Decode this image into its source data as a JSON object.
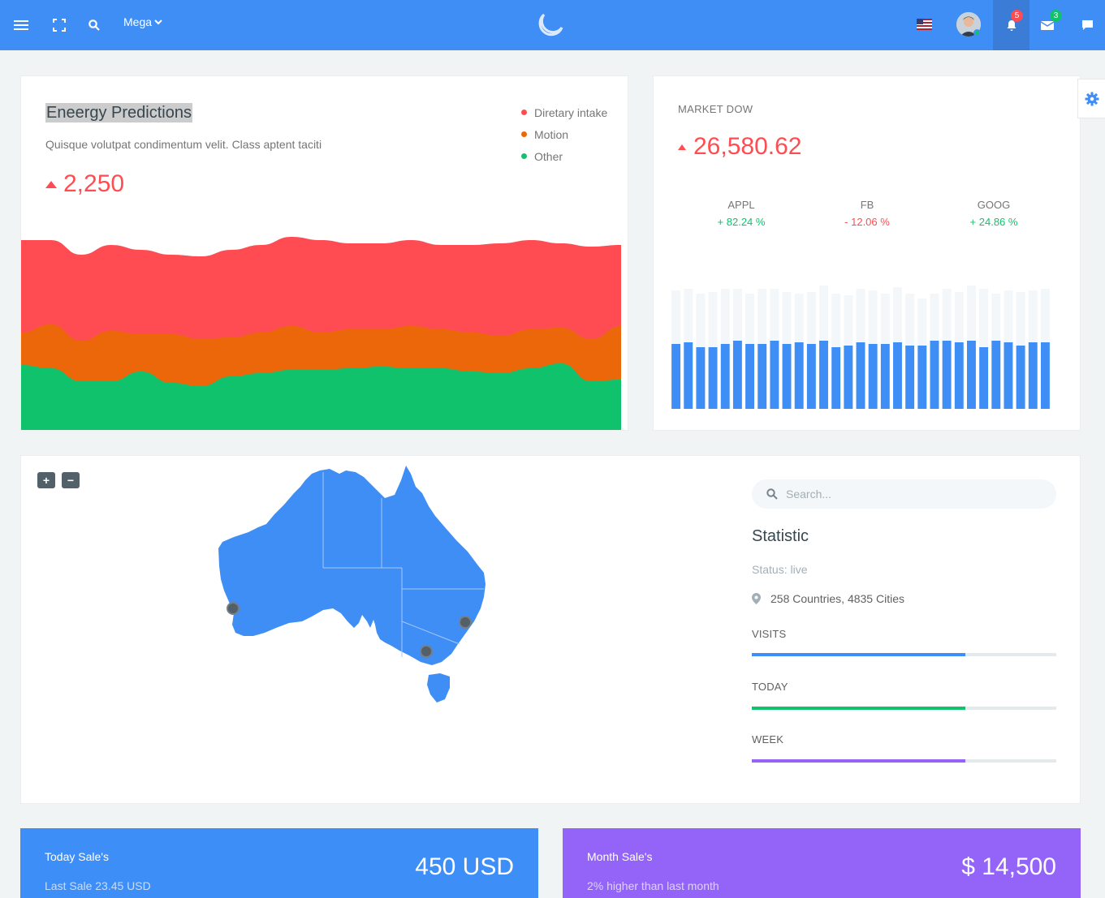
{
  "navbar": {
    "menu_icon": "hamburger-menu-icon",
    "fullscreen_icon": "fullscreen-icon",
    "search_icon": "search-icon",
    "mega_label": "Mega",
    "notifications_count": "5",
    "messages_count": "3",
    "brand_color": "#3f8ef6"
  },
  "energy": {
    "title": "Eneergy Predictions",
    "subtitle": "Quisque volutpat condimentum velit. Class aptent taciti",
    "value": "2,250",
    "legend": [
      {
        "label": "Diretary intake",
        "color": "#ff4c52"
      },
      {
        "label": "Motion",
        "color": "#eb6709"
      },
      {
        "label": "Other",
        "color": "#11c26d"
      }
    ]
  },
  "chart_data": [
    {
      "type": "area",
      "title": "Eneergy Predictions",
      "stacked": true,
      "series": [
        {
          "name": "Other",
          "color": "#11c26d",
          "values": [
            40,
            38,
            30,
            30,
            36,
            29,
            27,
            33,
            35,
            37,
            37,
            38,
            39,
            38,
            38,
            36,
            35,
            38,
            41,
            30,
            31
          ]
        },
        {
          "name": "Motion",
          "color": "#eb6709",
          "values": [
            20,
            27,
            25,
            31,
            23,
            30,
            29,
            24,
            25,
            27,
            23,
            24,
            23,
            26,
            24,
            24,
            23,
            24,
            22,
            26,
            33
          ]
        },
        {
          "name": "Diretary intake",
          "color": "#ff4c52",
          "values": [
            57,
            52,
            53,
            53,
            52,
            49,
            51,
            54,
            54,
            55,
            57,
            53,
            53,
            53,
            52,
            54,
            57,
            55,
            52,
            57,
            50
          ]
        }
      ]
    },
    {
      "type": "bar",
      "title": "MARKET DOW",
      "series": [
        {
          "name": "background",
          "color": "#f3f7f9",
          "values": [
            73,
            74,
            71,
            72,
            74,
            74,
            71,
            74,
            74,
            72,
            71,
            72,
            76,
            71,
            70,
            74,
            73,
            71,
            75,
            71,
            68,
            71,
            74,
            72,
            76,
            74,
            71,
            73,
            72
          ]
        },
        {
          "name": "value",
          "color": "#3f8ef6",
          "values": [
            40,
            41,
            38,
            38,
            40,
            42,
            40,
            40,
            42,
            40,
            41,
            40,
            42,
            38,
            39,
            41,
            40,
            40,
            41,
            39,
            39,
            42,
            42,
            41,
            42,
            38,
            42,
            41,
            39,
            41,
            41
          ]
        }
      ]
    }
  ],
  "market": {
    "title": "MARKET DOW",
    "value": "26,580.62",
    "tickers": [
      {
        "name": "APPL",
        "change": "+ 82.24 %",
        "color": "#11c26d"
      },
      {
        "name": "FB",
        "change": "- 12.06 %",
        "color": "#ff4c52"
      },
      {
        "name": "GOOG",
        "change": "+ 24.86 %",
        "color": "#11c26d"
      }
    ]
  },
  "map": {
    "zoom_in": "+",
    "zoom_out": "−",
    "region": "Australia",
    "map_color": "#3f8ef6",
    "marker_color": "#526069"
  },
  "stats": {
    "search_placeholder": "Search...",
    "title": "Statistic",
    "status": "Status: live",
    "location": "258 Countries, 4835 Cities",
    "bars": [
      {
        "label": "VISITS",
        "percent": 70,
        "color": "#3e8ef7"
      },
      {
        "label": "TODAY",
        "percent": 70,
        "color": "#11c26d"
      },
      {
        "label": "WEEK",
        "percent": 70,
        "color": "#9463f7"
      }
    ]
  },
  "sales": {
    "today": {
      "title": "Today Sale's",
      "subtitle": "Last Sale 23.45 USD",
      "value": "450 USD",
      "color": "#3e8ef7"
    },
    "month": {
      "title": "Month Sale's",
      "subtitle": "2% higher than last month",
      "value": "$ 14,500",
      "color": "#9463f7"
    }
  }
}
